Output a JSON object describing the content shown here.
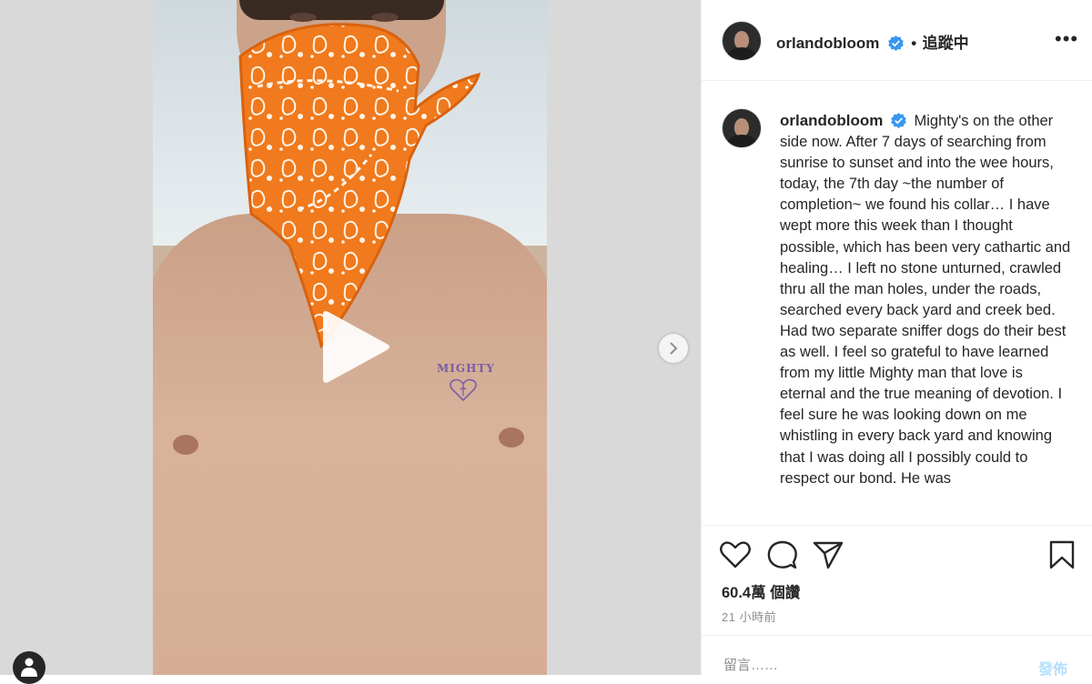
{
  "post": {
    "username": "orlandobloom",
    "follow_separator": "•",
    "follow_label": "追蹤中",
    "more_label": "•••",
    "caption": "Mighty's on the other side now. After 7 days of searching from sunrise to sunset and into the wee hours, today, the 7th day ~the number of completion~ we found his collar… I have wept more this week than I thought possible, which has been very cathartic and healing… I left no stone unturned, crawled thru all the man holes, under the roads, searched every back yard and creek bed. Had two separate sniffer dogs do their best as well. I feel so grateful to have learned from my little Mighty man that love is eternal and the true meaning of devotion. I feel sure he was looking down on me whistling in every back yard and knowing that I was doing all I possibly could to respect our bond. He was",
    "likes": "60.4萬 個讚",
    "time_ago": "21 小時前"
  },
  "media": {
    "tattoo_text": "MIGHTY",
    "accent_color": "#f07a1d"
  },
  "comment": {
    "placeholder": "留言……",
    "post_label": "發佈"
  },
  "icons": [
    "verified-badge-icon",
    "more-icon",
    "heart-icon",
    "comment-icon",
    "share-icon",
    "bookmark-icon",
    "play-icon",
    "chevron-right-icon",
    "profile-icon"
  ],
  "colors": {
    "verified": "#3897f0",
    "post_button": "#b2dffc",
    "text": "#262626",
    "muted": "#8e8e8e"
  }
}
